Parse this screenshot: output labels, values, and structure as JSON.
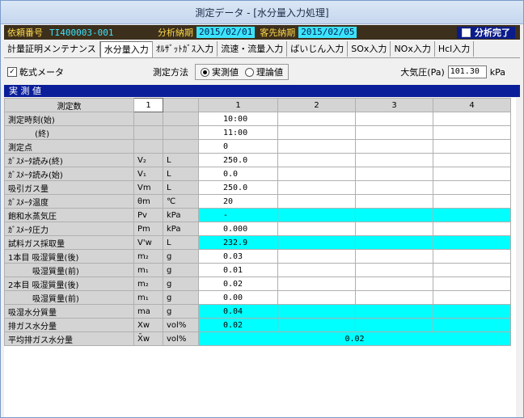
{
  "window": {
    "title": "測定データ - [水分量入力処理]"
  },
  "info": {
    "request_label": "依頼番号",
    "request_value": "TI400003-001",
    "analysis_label": "分析納期",
    "analysis_value": "2015/02/01",
    "client_label": "客先納期",
    "client_value": "2015/02/05",
    "complete_label": "分析完了"
  },
  "tabs": [
    "計量証明メンテナンス",
    "水分量入力",
    "ｵﾙｻﾞｯﾄｶﾞｽ入力",
    "流速・流量入力",
    "ばいじん入力",
    "SOx入力",
    "NOx入力",
    "Hcl入力"
  ],
  "options": {
    "dry_meter_label": "乾式メータ",
    "dry_meter_mark": "✓",
    "method_label": "測定方法",
    "method_measured": "実測値",
    "method_theory": "理論値",
    "pressure_label": "大気圧(Pa)",
    "pressure_value": "101.30",
    "pressure_unit": "kPa"
  },
  "section_title": "実 測 値",
  "grid": {
    "count_label": "測定数",
    "count_value": "1",
    "columns": [
      "1",
      "2",
      "3",
      "4"
    ],
    "rows": [
      {
        "label": "測定時刻(始)",
        "sym": "",
        "unit": "",
        "v1": "10:00",
        "calc": false
      },
      {
        "label": "　　　 (終)",
        "sym": "",
        "unit": "",
        "v1": "11:00",
        "calc": false
      },
      {
        "label": "測定点",
        "sym": "",
        "unit": "",
        "v1": "0",
        "calc": false
      },
      {
        "label": "ｶﾞｽﾒｰﾀ読み(終)",
        "sym": "V₂",
        "unit": "L",
        "v1": "250.0",
        "calc": false
      },
      {
        "label": "ｶﾞｽﾒｰﾀ読み(始)",
        "sym": "V₁",
        "unit": "L",
        "v1": "0.0",
        "calc": false
      },
      {
        "label": "吸引ガス量",
        "sym": "Vm",
        "unit": "L",
        "v1": "250.0",
        "calc": false
      },
      {
        "label": "ｶﾞｽﾒｰﾀ温度",
        "sym": "θm",
        "unit": "℃",
        "v1": "20",
        "calc": false
      },
      {
        "label": "飽和水蒸気圧",
        "sym": "Pv",
        "unit": "kPa",
        "v1": "-",
        "calc": true
      },
      {
        "label": "ｶﾞｽﾒｰﾀ圧力",
        "sym": "Pm",
        "unit": "kPa",
        "v1": "0.000",
        "calc": false
      },
      {
        "label": "試料ガス採取量",
        "sym": "V'w",
        "unit": "L",
        "v1": "232.9",
        "calc": true
      },
      {
        "label": "1本目 吸湿質量(後)",
        "sym": "m₂",
        "unit": "g",
        "v1": "0.03",
        "calc": false
      },
      {
        "label": "　　　吸湿質量(前)",
        "sym": "m₁",
        "unit": "g",
        "v1": "0.01",
        "calc": false
      },
      {
        "label": "2本目 吸湿質量(後)",
        "sym": "m₂",
        "unit": "g",
        "v1": "0.02",
        "calc": false
      },
      {
        "label": "　　　吸湿質量(前)",
        "sym": "m₁",
        "unit": "g",
        "v1": "0.00",
        "calc": false
      },
      {
        "label": "吸湿水分質量",
        "sym": "ma",
        "unit": "g",
        "v1": "0.04",
        "calc": true
      },
      {
        "label": "排ガス水分量",
        "sym": "Xw",
        "unit": "vol%",
        "v1": "0.02",
        "calc": true
      }
    ],
    "avg_label": "平均排ガス水分量",
    "avg_sym": "X̄w",
    "avg_unit": "vol%",
    "avg_value": "0.02"
  }
}
